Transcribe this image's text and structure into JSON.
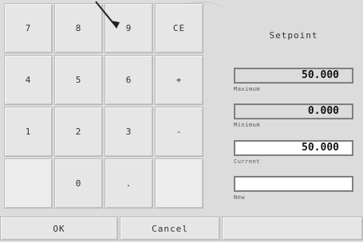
{
  "keypad": {
    "rows": [
      [
        "7",
        "8",
        "9",
        "CE"
      ],
      [
        "4",
        "5",
        "6",
        "+"
      ],
      [
        "1",
        "2",
        "3",
        "-"
      ],
      [
        "",
        "0",
        ".",
        ""
      ]
    ]
  },
  "panel": {
    "title": "Setpoint",
    "maximum_label": "Maximum",
    "maximum_value": "50.000",
    "minimum_label": "Minimum",
    "minimum_value": "0.000",
    "current_label": "Current",
    "current_value": "50.000",
    "new_label": "New",
    "new_value": ""
  },
  "footer": {
    "ok_label": "OK",
    "cancel_label": "Cancel"
  }
}
